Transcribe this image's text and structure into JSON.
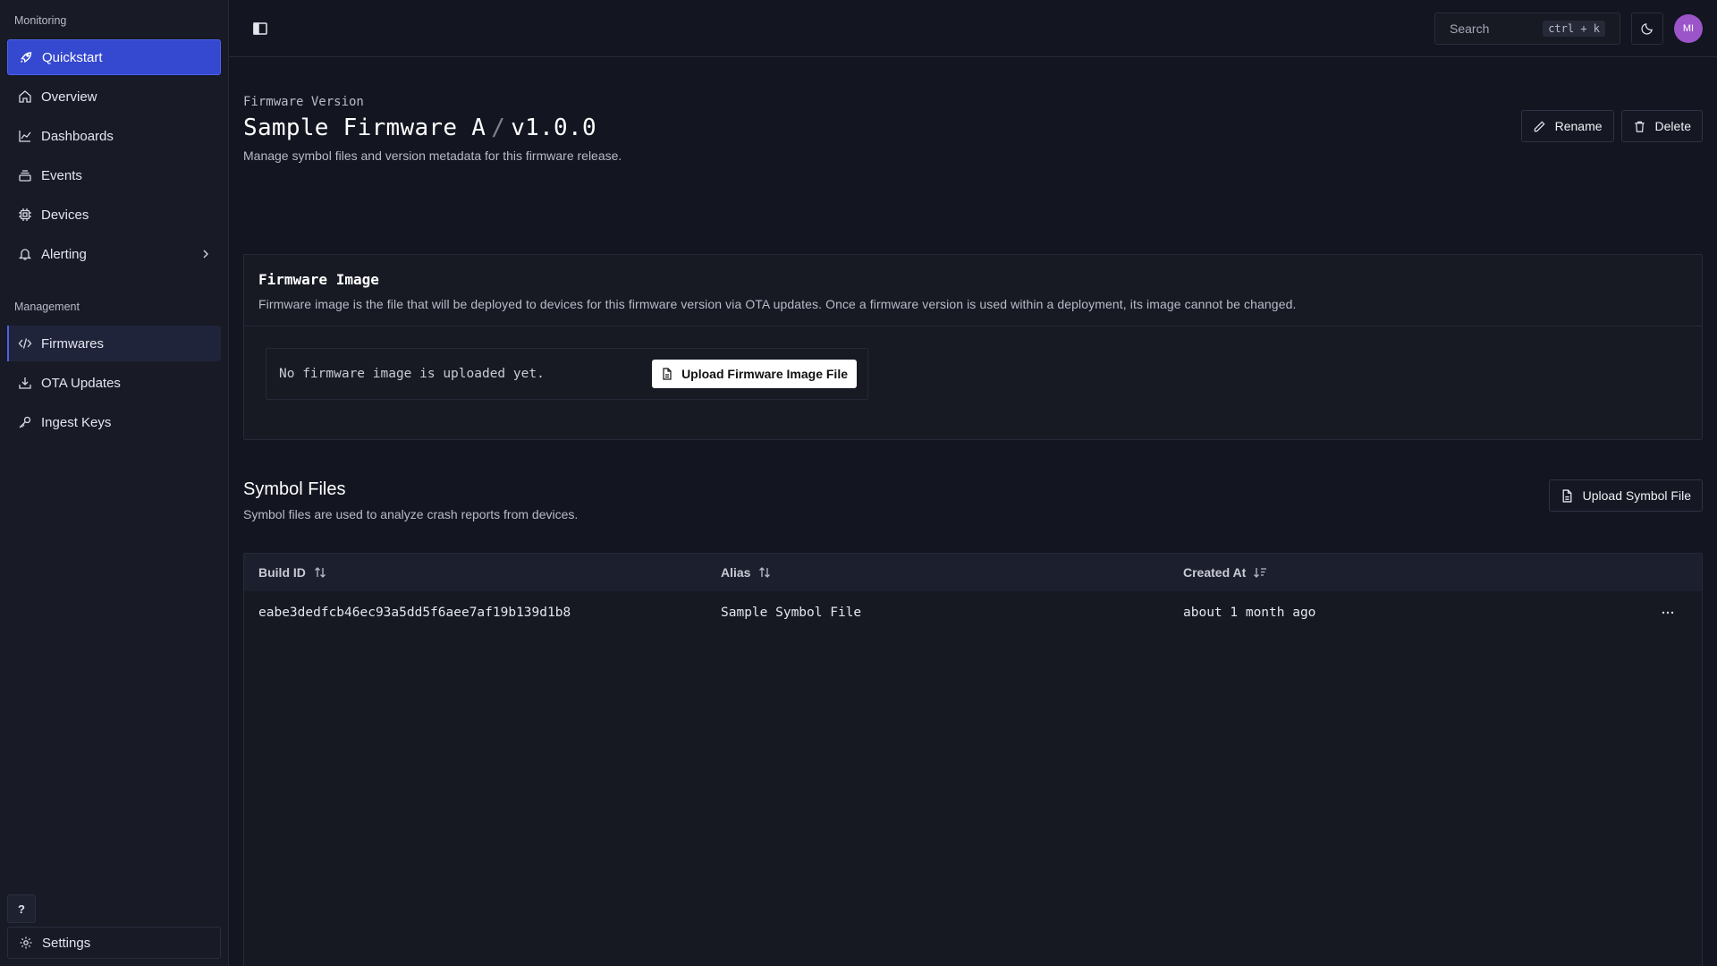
{
  "sidebar": {
    "monitoring_label": "Monitoring",
    "management_label": "Management",
    "items": [
      {
        "label": "Quickstart",
        "icon": "rocket-icon"
      },
      {
        "label": "Overview",
        "icon": "home-icon"
      },
      {
        "label": "Dashboards",
        "icon": "line-chart-icon"
      },
      {
        "label": "Events",
        "icon": "layers-icon"
      },
      {
        "label": "Devices",
        "icon": "chip-icon"
      },
      {
        "label": "Alerting",
        "icon": "bell-icon"
      }
    ],
    "management_items": [
      {
        "label": "Firmwares",
        "icon": "code-icon"
      },
      {
        "label": "OTA Updates",
        "icon": "download-icon"
      },
      {
        "label": "Ingest Keys",
        "icon": "key-icon"
      }
    ],
    "help_label": "?",
    "settings_label": "Settings"
  },
  "topbar": {
    "search_label": "Search",
    "search_shortcut": "ctrl + k",
    "avatar_initials": "MI"
  },
  "header": {
    "eyebrow": "Firmware Version",
    "firmware_name": "Sample Firmware A",
    "separator": "/",
    "version": "v1.0.0",
    "subtitle": "Manage symbol files and version metadata for this firmware release.",
    "rename_label": "Rename",
    "delete_label": "Delete"
  },
  "firmware_image": {
    "title": "Firmware Image",
    "description": "Firmware image is the file that will be deployed to devices for this firmware version via OTA updates. Once a firmware version is used within a deployment, its image cannot be changed.",
    "empty_text": "No firmware image is uploaded yet.",
    "upload_label": "Upload Firmware Image File"
  },
  "symbol_files": {
    "title": "Symbol Files",
    "description": "Symbol files are used to analyze crash reports from devices.",
    "upload_label": "Upload Symbol File",
    "columns": [
      "Build ID",
      "Alias",
      "Created At"
    ],
    "rows": [
      {
        "build_id": "eabe3dedfcb46ec93a5dd5f6aee7af19b139d1b8",
        "alias": "Sample Symbol File",
        "created_at": "about 1 month ago"
      }
    ]
  },
  "colors": {
    "accent": "#3548d0",
    "background": "#131520",
    "avatar": "#9b55c9"
  }
}
